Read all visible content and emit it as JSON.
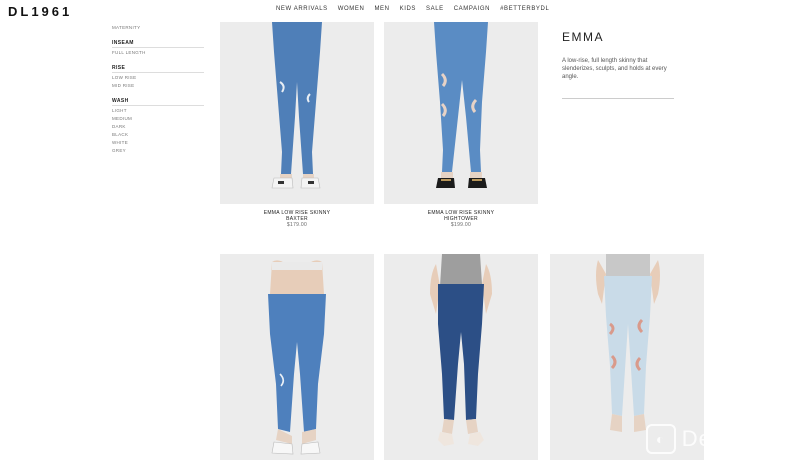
{
  "brand": {
    "logo": "DL1961"
  },
  "nav": [
    "NEW ARRIVALS",
    "WOMEN",
    "MEN",
    "KIDS",
    "SALE",
    "CAMPAIGN",
    "#BETTERBYDL"
  ],
  "sidebar": {
    "top_item": "MATERNITY",
    "groups": [
      {
        "title": "INSEAM",
        "items": [
          "FULL LENGTH"
        ]
      },
      {
        "title": "RISE",
        "items": [
          "LOW RISE",
          "MID RISE"
        ]
      },
      {
        "title": "WASH",
        "items": [
          "LIGHT",
          "MEDIUM",
          "DARK",
          "BLACK",
          "WHITE",
          "GREY"
        ]
      }
    ]
  },
  "products": [
    {
      "name": "EMMA LOW RISE SKINNY",
      "variant": "BAXTER",
      "price": "$179.00"
    },
    {
      "name": "EMMA LOW RISE SKINNY",
      "variant": "HIGHTOWER",
      "price": "$199.00"
    }
  ],
  "feature": {
    "title": "EMMA",
    "description": "A low-rise, full length skinny that slenderizes, sculpts, and holds at every angle."
  },
  "watermark": {
    "text": "DealMoon"
  },
  "colors": {
    "background": "#ffffff",
    "card_bg": "#ededed",
    "denim_medium": "#4f7fb8",
    "denim_dark": "#2c4f86",
    "denim_light": "#c9dbe8"
  }
}
